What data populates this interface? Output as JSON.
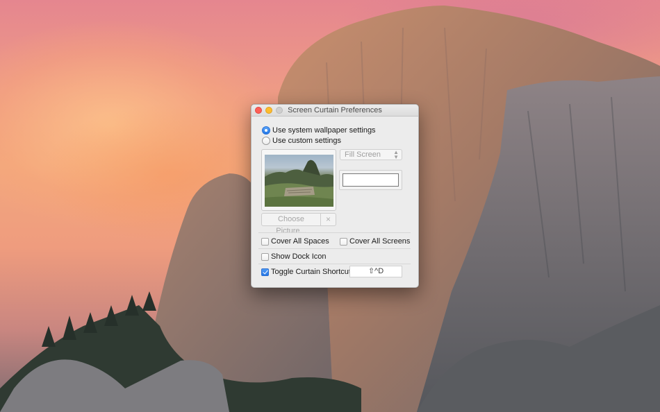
{
  "window": {
    "title": "Screen Curtain Preferences"
  },
  "wallpaper": {
    "system_label": "Use system wallpaper settings",
    "custom_label": "Use custom settings",
    "selected": "system",
    "choose_picture_label": "Choose Picture...",
    "clear_icon": "×",
    "fill_mode": "Fill Screen",
    "background_color": "#ffffff"
  },
  "options": {
    "cover_all_spaces": {
      "label": "Cover All Spaces",
      "checked": false
    },
    "cover_all_screens": {
      "label": "Cover All Screens",
      "checked": false
    },
    "show_dock_icon": {
      "label": "Show Dock Icon",
      "checked": false
    },
    "toggle_shortcut": {
      "label": "Toggle Curtain Shortcut",
      "checked": true,
      "value": "⇧^D"
    }
  },
  "colors": {
    "accent": "#2477e6",
    "close": "#fd5f57",
    "minimize": "#fdbc2e",
    "zoom": "#cfcfcf"
  }
}
